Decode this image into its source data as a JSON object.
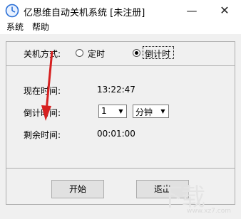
{
  "window": {
    "title": "亿思维自动关机系统 [未注册]",
    "minimize_glyph": "—",
    "close_glyph": "✕"
  },
  "menu": {
    "items": [
      "系统",
      "帮助"
    ]
  },
  "mode": {
    "label": "关机方式:",
    "options": [
      {
        "label": "定时",
        "selected": false
      },
      {
        "label": "倒计时",
        "selected": true
      }
    ]
  },
  "info": {
    "current_time_label": "现在时间:",
    "current_time_value": "13:22:47",
    "countdown_label": "倒计时间:",
    "countdown_amount": "1",
    "countdown_unit": "分钟",
    "remaining_label": "剩余时间:",
    "remaining_value": "00:01:00"
  },
  "buttons": {
    "start": "开始",
    "exit": "退出"
  },
  "watermark": {
    "text": "下载",
    "sub": "www.xz7.com"
  },
  "colors": {
    "arrow": "#d62020",
    "icon_bg": "#2a6fd6"
  }
}
